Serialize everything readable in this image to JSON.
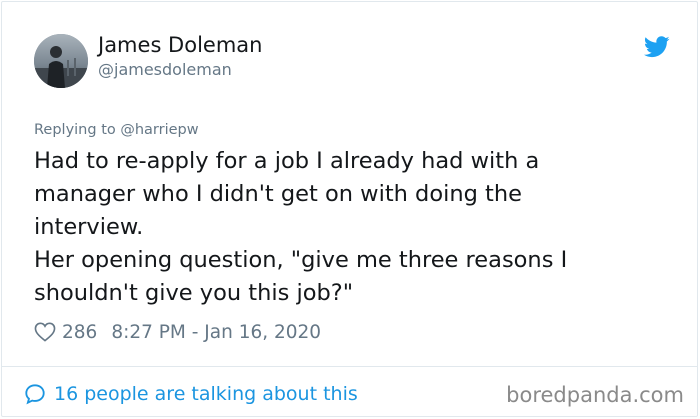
{
  "tweet": {
    "author_name": "James Doleman",
    "author_handle": "@jamesdoleman",
    "replying_prefix": "Replying to",
    "replying_handle": "@harriepw",
    "text_lines": [
      "Had to re-apply for a job I already had with a",
      "manager who I didn't get on with doing the",
      "interview.",
      "Her opening question, \"give me three reasons I",
      "shouldn't give you this job?\""
    ],
    "like_count": "286",
    "timestamp": "8:27 PM - Jan 16, 2020",
    "talking_text": "16 people are talking about this"
  },
  "watermark": "boredpanda.com",
  "icons": {
    "logo": "twitter-bird-icon",
    "like": "heart-icon",
    "talking": "speech-bubble-icon"
  },
  "colors": {
    "text": "#14171a",
    "muted": "#657786",
    "link_blue": "#1b95e0",
    "twitter_blue": "#1da1f2",
    "border": "#e1e8ed",
    "watermark": "#8a8a8a"
  }
}
